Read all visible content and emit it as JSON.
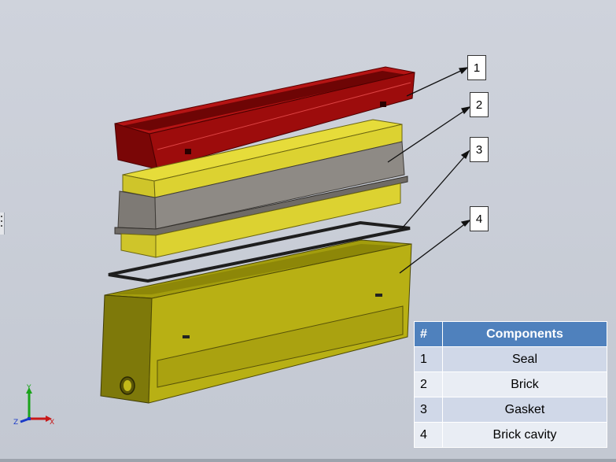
{
  "callouts": [
    "1",
    "2",
    "3",
    "4"
  ],
  "table": {
    "headers": [
      "#",
      "Components"
    ],
    "rows": [
      {
        "num": "1",
        "name": "Seal"
      },
      {
        "num": "2",
        "name": "Brick"
      },
      {
        "num": "3",
        "name": "Gasket"
      },
      {
        "num": "4",
        "name": "Brick cavity"
      }
    ],
    "header_color": "#4f81bd"
  },
  "triad": {
    "x": "X",
    "y": "Y",
    "z": "Z"
  },
  "colors": {
    "seal": "#8b0a0a",
    "brick_yellow": "#d6cc2a",
    "brick_gray": "#8a8580",
    "gasket": "#2a2a2a",
    "cavity": "#b3ac12",
    "background": "#c6cbd5"
  }
}
